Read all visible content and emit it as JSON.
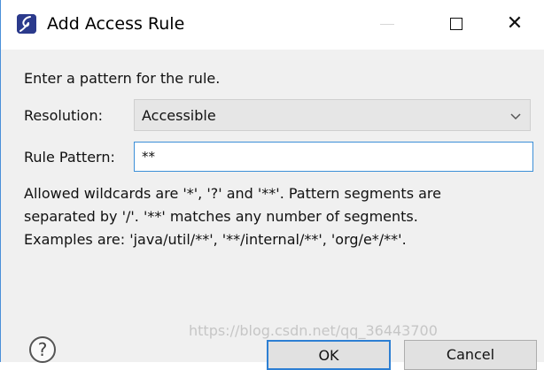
{
  "window": {
    "title": "Add Access Rule",
    "app_icon": "eclipse-app-icon"
  },
  "titlebar_controls": {
    "minimize_icon": "minimize-icon",
    "maximize_icon": "maximize-icon",
    "close_icon": "close-icon",
    "close_glyph": "✕"
  },
  "form": {
    "instruction": "Enter a pattern for the rule.",
    "resolution_label": "Resolution:",
    "resolution_value": "Accessible",
    "rule_pattern_label": "Rule Pattern:",
    "rule_pattern_value": "**"
  },
  "help_text": {
    "line1": "Allowed wildcards are '*', '?' and '**'. Pattern segments are",
    "line2": "separated by '/'. '**' matches any number of segments.",
    "line3": "Examples are: 'java/util/**', '**/internal/**', 'org/e*/**'."
  },
  "footer": {
    "help_glyph": "?",
    "ok_label": "OK",
    "cancel_label": "Cancel",
    "watermark": "https://blog.csdn.net/qq_36443700"
  },
  "colors": {
    "focus_accent": "#3c8fd8",
    "dialog_background": "#f0f0f0",
    "select_background": "#e6e6e6"
  }
}
